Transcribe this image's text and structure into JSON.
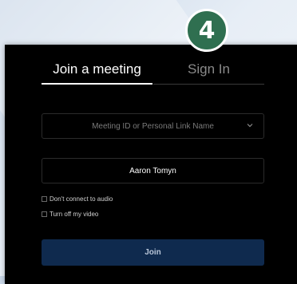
{
  "step_badge": {
    "number": "4",
    "color": "#2f6f50"
  },
  "tabs": [
    {
      "label": "Join a meeting",
      "active": true
    },
    {
      "label": "Sign In",
      "active": false
    }
  ],
  "meeting_field": {
    "value": "",
    "placeholder": "Meeting ID or Personal Link Name",
    "icon": "chevron-down-icon"
  },
  "name_field": {
    "value": "Aaron Tomyn"
  },
  "options": [
    {
      "label": "Don't connect to audio",
      "checked": false
    },
    {
      "label": "Turn off my video",
      "checked": false
    }
  ],
  "join_button": {
    "label": "Join",
    "color": "#0f2a4e"
  }
}
